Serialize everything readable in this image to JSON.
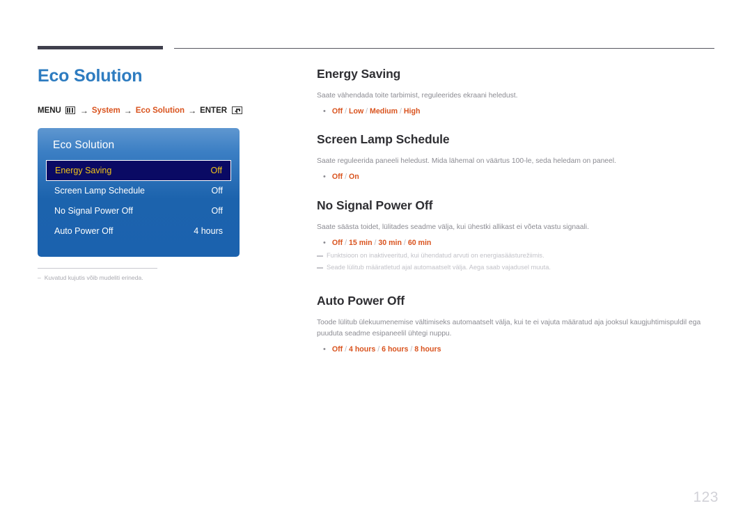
{
  "page": {
    "title": "Eco Solution",
    "number": "123"
  },
  "breadcrumb": {
    "menu_label": "MENU",
    "menu_icon": "menu-grid-icon",
    "arrow": "→",
    "step1": "System",
    "step2": "Eco Solution",
    "enter_label": "ENTER",
    "enter_icon": "enter-return-icon"
  },
  "osd": {
    "title": "Eco Solution",
    "rows": [
      {
        "label": "Energy Saving",
        "value": "Off",
        "selected": true
      },
      {
        "label": "Screen Lamp Schedule",
        "value": "Off",
        "selected": false
      },
      {
        "label": "No Signal Power Off",
        "value": "Off",
        "selected": false
      },
      {
        "label": "Auto Power Off",
        "value": "4 hours",
        "selected": false
      }
    ],
    "footnote": {
      "dash": "–",
      "text": "Kuvatud kujutis võib mudeliti erineda."
    }
  },
  "sections": [
    {
      "heading": "Energy Saving",
      "body": "Saate vähendada toite tarbimist, reguleerides ekraani heledust.",
      "bullet": "•",
      "options": "Off / Low / Medium / High",
      "notes": []
    },
    {
      "heading": "Screen Lamp Schedule",
      "body": "Saate reguleerida paneeli heledust. Mida lähemal on väärtus 100-le, seda heledam on paneel.",
      "bullet": "•",
      "options": "Off / On",
      "notes": []
    },
    {
      "heading": "No Signal Power Off",
      "body": "Saate säästa toidet, lülitades seadme välja, kui ühestki allikast ei võeta vastu signaali.",
      "bullet": "•",
      "options": "Off / 15 min / 30 min / 60 min",
      "notes": [
        "Funktsioon on inaktiveeritud, kui ühendatud arvuti on energiasäästurežiimis.",
        "Seade lülitub määratletud ajal automaatselt välja. Aega saab vajadusel muuta."
      ]
    },
    {
      "heading": "Auto Power Off",
      "body": "Toode lülitub ülekuumenemise vältimiseks automaatselt välja, kui te ei vajuta määratud aja jooksul kaugjuhtimispuldil ega puuduta seadme esipaneelil ühtegi nuppu.",
      "bullet": "•",
      "options": "Off / 4 hours / 6 hours / 8 hours",
      "notes": []
    }
  ],
  "colors": {
    "title_blue": "#2e7cc0",
    "accent_orange": "#d9531e",
    "osd_blue": "#1c63ad",
    "osd_selected_bg": "#0a0a64",
    "osd_selected_text": "#f0c419"
  }
}
